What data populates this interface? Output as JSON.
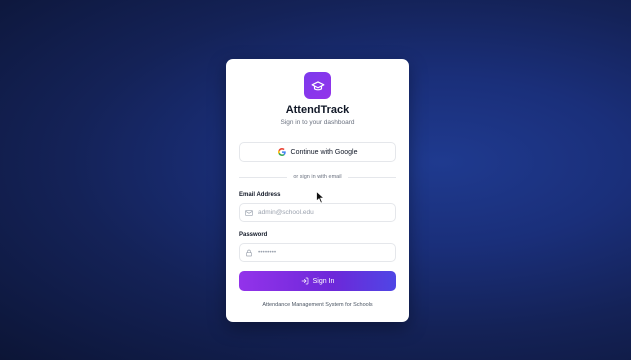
{
  "app": {
    "title": "AttendTrack",
    "subtitle": "Sign in to your dashboard",
    "logo_icon": "graduation-cap-icon",
    "accent_color": "#7c3aed"
  },
  "google": {
    "label": "Continue with Google",
    "icon": "google-icon"
  },
  "divider": {
    "text": "or sign in with email"
  },
  "email": {
    "label": "Email Address",
    "placeholder": "admin@school.edu",
    "value": "",
    "icon": "mail-icon"
  },
  "password": {
    "label": "Password",
    "placeholder": "••••••••",
    "value": "",
    "icon": "lock-icon"
  },
  "signin": {
    "label": "Sign In",
    "icon": "login-arrow-icon"
  },
  "footer": {
    "text": "Attendance Management System for Schools"
  }
}
